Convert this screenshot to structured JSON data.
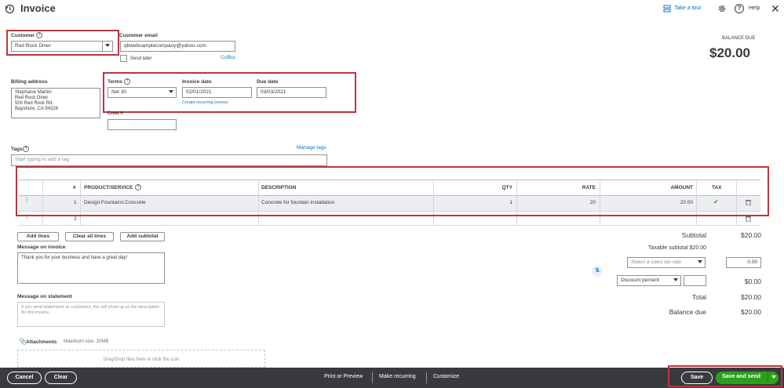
{
  "header": {
    "title": "Invoice",
    "take_tour": "Take a tour",
    "help": "Help"
  },
  "customer": {
    "label": "Customer",
    "value": "Red Rock Diner"
  },
  "email": {
    "label": "Customer email",
    "value": "qbwebsamplecompany@yahoo.com",
    "cc_bcc": "Cc/Bcc",
    "send_later": "Send later"
  },
  "balance": {
    "label": "BALANCE DUE",
    "amount": "$20.00"
  },
  "billing": {
    "label": "Billing address",
    "lines": [
      "Stephanie Martini",
      "Red Rock Diner",
      "500 Red Rock Rd.",
      "Bayshore, CA  94326"
    ]
  },
  "terms": {
    "label": "Terms",
    "value": "Net 30"
  },
  "invoice_date": {
    "label": "Invoice date",
    "value": "02/01/2021",
    "recurring_link": "Create recurring invoice"
  },
  "due_date": {
    "label": "Due date",
    "value": "03/03/2021"
  },
  "crew": {
    "label": "Crew #"
  },
  "tags": {
    "label": "Tags",
    "manage": "Manage tags",
    "placeholder": "Start typing to add a tag"
  },
  "table": {
    "headers": [
      "#",
      "PRODUCT/SERVICE",
      "DESCRIPTION",
      "QTY",
      "RATE",
      "AMOUNT",
      "TAX"
    ],
    "rows": [
      {
        "num": "1",
        "product": "Design:Fountains:Concrete",
        "description": "Concrete for fountain installation",
        "qty": "1",
        "rate": "20",
        "amount": "20.00"
      },
      {
        "num": "2",
        "product": "",
        "description": "",
        "qty": "",
        "rate": "",
        "amount": ""
      }
    ]
  },
  "line_buttons": {
    "add_lines": "Add lines",
    "clear_all": "Clear all lines",
    "add_subtotal": "Add subtotal"
  },
  "message_invoice": {
    "label": "Message on invoice",
    "value": "Thank you for your business and have a great day!"
  },
  "message_statement": {
    "label": "Message on statement",
    "placeholder": "If you send statements to customers, this will show up as the description for this invoice."
  },
  "attachments": {
    "label": "Attachments",
    "max_size": "Maximum size: 20MB",
    "drop_text": "Drag/Drop files here or click the icon"
  },
  "totals": {
    "subtotal_label": "Subtotal",
    "subtotal": "$20.00",
    "taxable_label": "Taxable subtotal $20.00",
    "tax_rate_placeholder": "Select a sales tax rate",
    "tax_value": "0.00",
    "discount_select": "Discount percent",
    "discount_value": "$0.00",
    "total_label": "Total",
    "total": "$20.00",
    "balance_label": "Balance due",
    "balance": "$20.00"
  },
  "footer": {
    "cancel": "Cancel",
    "clear": "Clear",
    "print": "Print or Preview",
    "recurring": "Make recurring",
    "customize": "Customize",
    "save": "Save",
    "save_send": "Save and send"
  },
  "colors": {
    "accent_green": "#2ca01c",
    "link_blue": "#0077c5",
    "highlight_red": "#b5383f",
    "footer_dark": "#393a3d"
  }
}
